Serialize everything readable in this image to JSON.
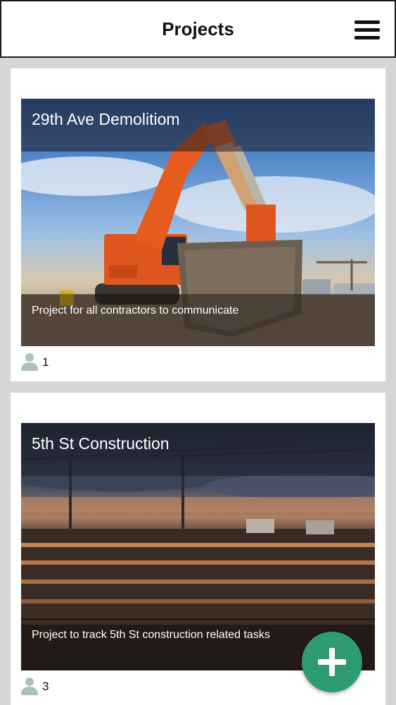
{
  "header": {
    "title": "Projects",
    "menu_icon": "hamburger-menu-icon"
  },
  "projects": [
    {
      "title": "29th Ave Demolitiom",
      "description": "Project for all contractors to communicate",
      "members": "1"
    },
    {
      "title": "5th St Construction",
      "description": "Project to track 5th St construction related tasks",
      "members": "3"
    }
  ],
  "fab": {
    "icon": "plus-icon",
    "color": "#2f9b73"
  },
  "colors": {
    "background": "#d6d6d6",
    "card": "#ffffff",
    "user_icon": "#a9c1c0"
  }
}
